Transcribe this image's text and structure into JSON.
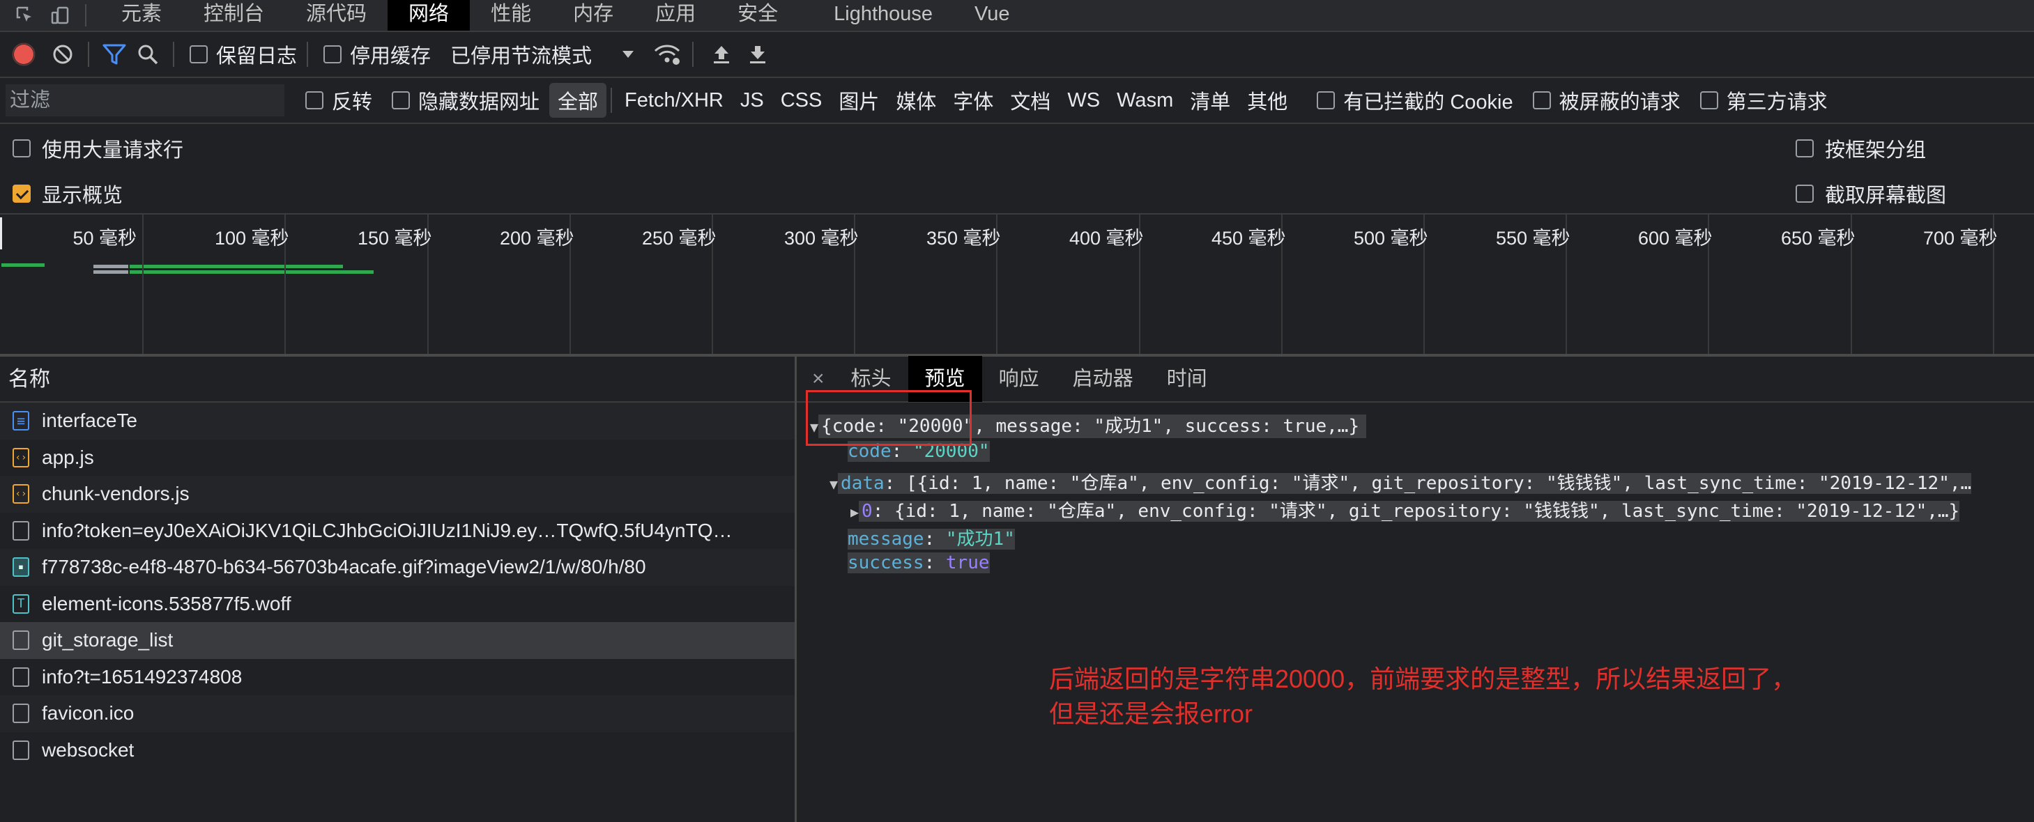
{
  "main_tabs": [
    "元素",
    "控制台",
    "源代码",
    "网络",
    "性能",
    "内存",
    "应用",
    "安全",
    "Lighthouse",
    "Vue"
  ],
  "active_main_tab": "网络",
  "toolbar": {
    "preserve_log": "保留日志",
    "disable_cache": "停用缓存",
    "throttling": "已停用节流模式"
  },
  "filter": {
    "placeholder": "过滤",
    "invert": "反转",
    "hide_data_urls": "隐藏数据网址",
    "types": [
      "全部",
      "Fetch/XHR",
      "JS",
      "CSS",
      "图片",
      "媒体",
      "字体",
      "文档",
      "WS",
      "Wasm",
      "清单",
      "其他"
    ],
    "blocked_cookies": "有已拦截的 Cookie",
    "blocked_requests": "被屏蔽的请求",
    "third_party": "第三方请求"
  },
  "options": {
    "large_rows": "使用大量请求行",
    "group_by_frame": "按框架分组",
    "show_overview": "显示概览",
    "capture_screenshots": "截取屏幕截图"
  },
  "timeline_ticks": [
    "50 毫秒",
    "100 毫秒",
    "150 毫秒",
    "200 毫秒",
    "250 毫秒",
    "300 毫秒",
    "350 毫秒",
    "400 毫秒",
    "450 毫秒",
    "500 毫秒",
    "550 毫秒",
    "600 毫秒",
    "650 毫秒",
    "700 毫秒"
  ],
  "requests": {
    "header": "名称",
    "items": [
      {
        "name": "interfaceTe",
        "type": "doc"
      },
      {
        "name": "app.js",
        "type": "js"
      },
      {
        "name": "chunk-vendors.js",
        "type": "js"
      },
      {
        "name": "info?token=eyJ0eXAiOiJKV1QiLCJhbGciOiJIUzI1NiJ9.ey…TQwfQ.5fU4ynTQ…",
        "type": "other"
      },
      {
        "name": "f778738c-e4f8-4870-b634-56703b4acafe.gif?imageView2/1/w/80/h/80",
        "type": "img"
      },
      {
        "name": "element-icons.535877f5.woff",
        "type": "font"
      },
      {
        "name": "git_storage_list",
        "type": "other"
      },
      {
        "name": "info?t=1651492374808",
        "type": "other"
      },
      {
        "name": "favicon.ico",
        "type": "other"
      },
      {
        "name": "websocket",
        "type": "other"
      }
    ],
    "selected": "git_storage_list"
  },
  "detail_tabs": [
    "标头",
    "预览",
    "响应",
    "启动器",
    "时间"
  ],
  "active_detail_tab": "预览",
  "preview": {
    "root_summary": "{code: \"20000\", message: \"成功1\", success: true,…}",
    "code_key": "code",
    "code_value": "\"20000\"",
    "data_key": "data",
    "data_summary": "[{id: 1, name: \"仓库a\", env_config: \"请求\", git_repository: \"钱钱钱\", last_sync_time: \"2019-12-12\",…",
    "item0_summary": "{id: 1, name: \"仓库a\", env_config: \"请求\", git_repository: \"钱钱钱\", last_sync_time: \"2019-12-12\",…}",
    "message_key": "message",
    "message_value": "\"成功1\"",
    "success_key": "success",
    "success_value": "true"
  },
  "annotation": {
    "line1": "后端返回的是字符串20000，前端要求的是整型，所以结果返回了，",
    "line2": "但是还是会报error"
  },
  "colors": {
    "annotation_red": "#e1302b",
    "record_red": "#e8554e",
    "filter_blue": "#4a8ff7",
    "checked_orange": "#f0a732",
    "waterfall_green": "#2fa84f"
  }
}
